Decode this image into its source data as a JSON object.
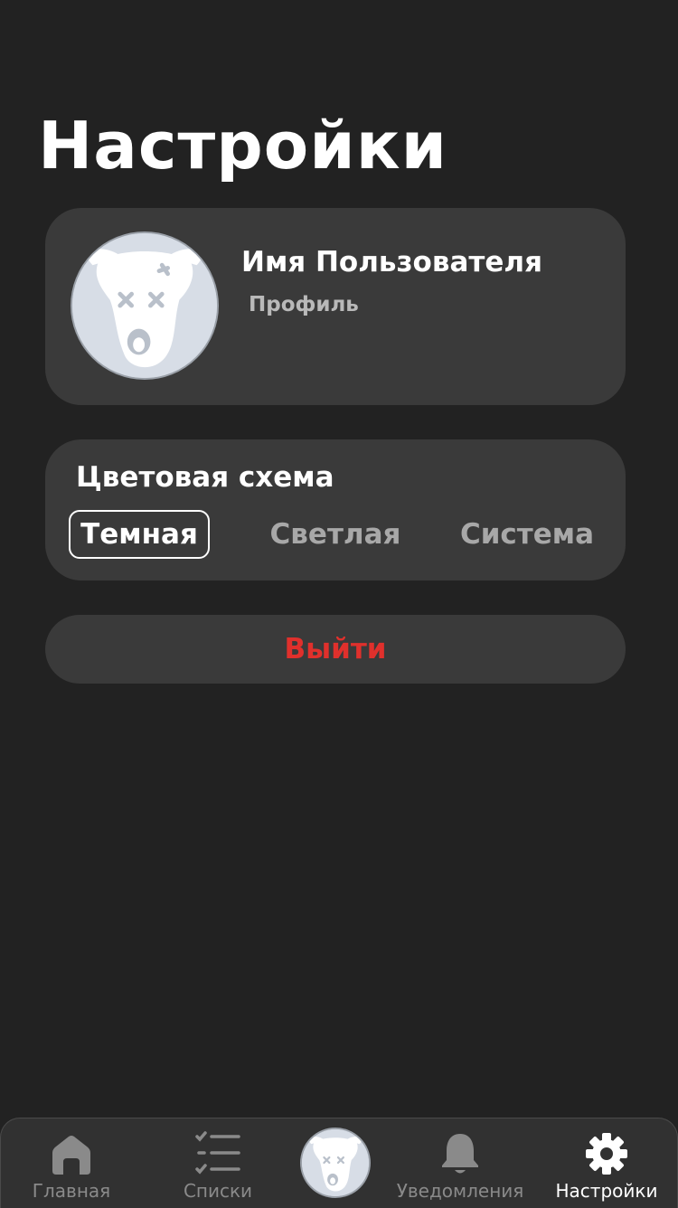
{
  "page": {
    "title": "Настройки"
  },
  "profile": {
    "name": "Имя Пользователя",
    "link": "Профиль",
    "avatar_icon": "dog-avatar-icon"
  },
  "color_scheme": {
    "title": "Цветовая схема",
    "options": [
      "Темная",
      "Светлая",
      "Система"
    ],
    "selected": "Темная"
  },
  "logout": {
    "label": "Выйти",
    "color": "#e0302c"
  },
  "tabbar": {
    "items": [
      {
        "label": "Главная",
        "icon": "home-icon",
        "active": false
      },
      {
        "label": "Списки",
        "icon": "checklist-icon",
        "active": false
      },
      {
        "label": "",
        "icon": "dog-avatar-icon",
        "active": false
      },
      {
        "label": "Уведомления",
        "icon": "bell-icon",
        "active": false
      },
      {
        "label": "Настройки",
        "icon": "gear-icon",
        "active": true
      }
    ]
  },
  "colors": {
    "background": "#222222",
    "card": "#3a3a3a",
    "accent_danger": "#e0302c",
    "inactive": "#8a8a8a"
  }
}
